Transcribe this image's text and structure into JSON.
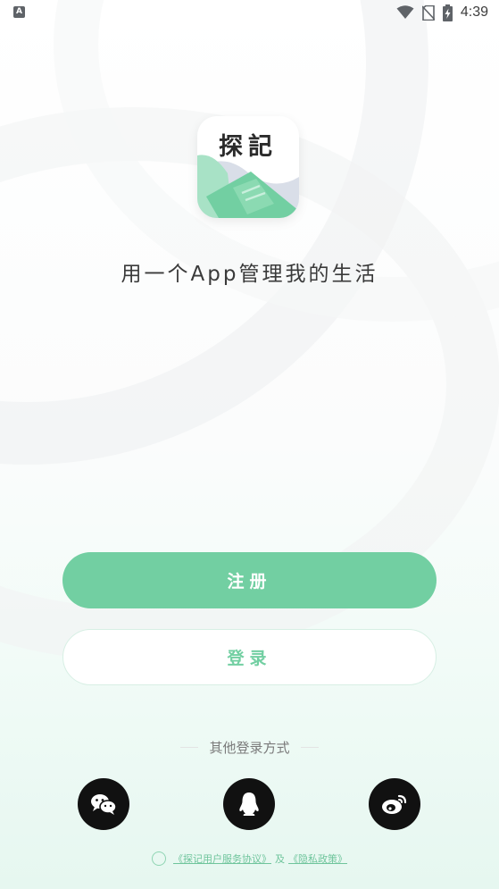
{
  "status_bar": {
    "notification_icon": "A",
    "time": "4:39",
    "icons": [
      "wifi-icon",
      "no-sim-icon",
      "battery-charging-icon"
    ]
  },
  "logo": {
    "text": "探記",
    "colors": {
      "green": "#72cfa2",
      "light_green": "#a8e2c6",
      "slate": "#b9c2d6"
    }
  },
  "slogan": "用一个App管理我的生活",
  "buttons": {
    "register": "注册",
    "login": "登录"
  },
  "other_login": {
    "label": "其他登录方式",
    "providers": [
      "wechat-icon",
      "qq-icon",
      "weibo-icon"
    ]
  },
  "agreement": {
    "terms": "《探记用户服务协议》",
    "and": "及",
    "privacy": "《隐私政策》"
  },
  "colors": {
    "accent": "#72cfa2",
    "social_bg": "#111111"
  }
}
